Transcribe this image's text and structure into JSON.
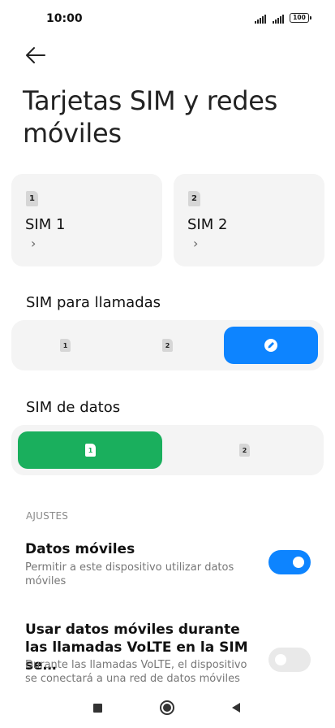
{
  "status_bar": {
    "time": "10:00",
    "battery": "100"
  },
  "page": {
    "title": "Tarjetas SIM y redes móviles"
  },
  "sims": [
    {
      "badge": "1",
      "name": "SIM 1",
      "chevron": "›"
    },
    {
      "badge": "2",
      "name": "SIM 2",
      "chevron": "›"
    }
  ],
  "calls": {
    "title": "SIM para llamadas",
    "options": [
      {
        "label": "1"
      },
      {
        "label": "2"
      },
      {
        "icon": "edit-icon",
        "selected": true
      }
    ],
    "accent": "#0d84ff"
  },
  "data_sim": {
    "title": "SIM de datos",
    "options": [
      {
        "label": "1",
        "selected": true
      },
      {
        "label": "2"
      }
    ],
    "accent": "#1aaf5d"
  },
  "settings": {
    "section_label": "AJUSTES",
    "mobile_data": {
      "title": "Datos móviles",
      "description": "Permitir a este dispositivo utilizar datos móviles",
      "enabled": true
    },
    "volte": {
      "title": "Usar datos móviles durante las llamadas VoLTE en la SIM se…",
      "description": "Durante las llamadas VoLTE, el dispositivo se conectará a una red de datos móviles",
      "enabled": false
    }
  },
  "nav_bar": {
    "recents": "recents-icon",
    "home": "home-icon",
    "back": "back-icon"
  }
}
